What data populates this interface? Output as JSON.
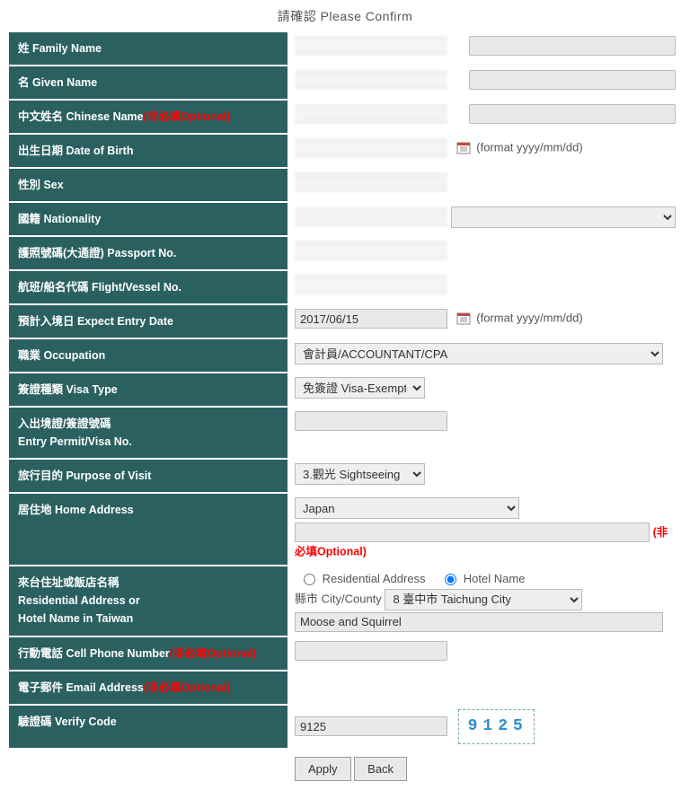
{
  "title": "請確認 Please Confirm",
  "optionalTag": "(非必填Optional)",
  "optionalTag2": "(非必填Optional)",
  "labels": {
    "familyName": "姓 Family Name",
    "givenName": "名 Given Name",
    "chineseName": "中文姓名 Chinese Name",
    "dob": "出生日期 Date of Birth",
    "sex": "性別 Sex",
    "nationality": "國籍 Nationality",
    "passport": "護照號碼(大通證) Passport No.",
    "flight": "航班/船名代碼 Flight/Vessel No.",
    "entryDate": "預計入境日 Expect Entry Date",
    "occupation": "職業 Occupation",
    "visaType": "簽證種類 Visa Type",
    "permit": "入出境證/簽證號碼",
    "permit2": "Entry Permit/Visa No.",
    "purpose": "旅行目的 Purpose of Visit",
    "homeAddr": "居住地 Home Address",
    "residential": "來台住址或飯店名稱",
    "residential2": "Residential Address or",
    "residential3": "Hotel Name in Taiwan",
    "cell": "行動電話 Cell Phone Number",
    "email": "電子郵件 Email Address",
    "verify": "驗證碼 Verify Code"
  },
  "values": {
    "entryDate": "2017/06/15",
    "formatHint": "(format yyyy/mm/dd)",
    "occupation": "會計員/ACCOUNTANT/CPA",
    "visaType": "免簽證 Visa-Exempt",
    "purpose": "3.觀光 Sightseeing",
    "homeCountry": "Japan",
    "addrTypeResidential": "Residential Address",
    "addrTypeHotel": "Hotel Name",
    "cityLabel": "縣市 City/County",
    "city": "8 臺中市 Taichung City",
    "hotelName": "Moose and Squirrel",
    "verifyInput": "9125",
    "captcha": "9125"
  },
  "buttons": {
    "apply": "Apply",
    "back": "Back"
  }
}
